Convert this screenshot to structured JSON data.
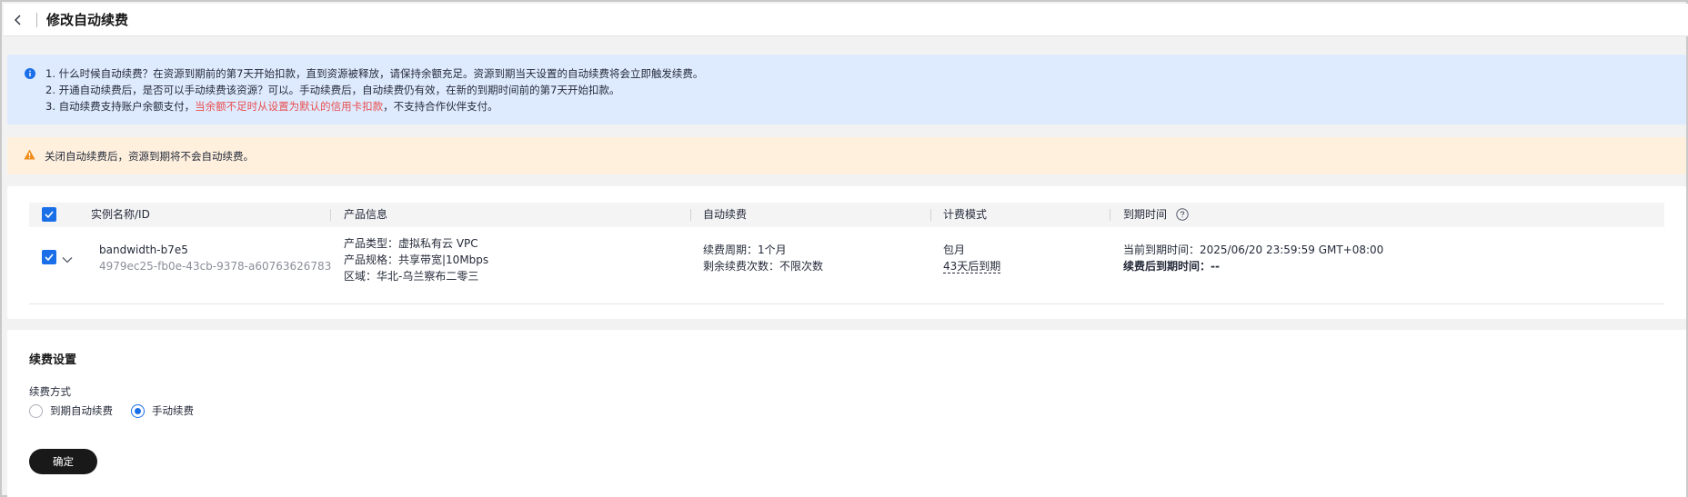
{
  "header": {
    "title": "修改自动续费"
  },
  "info_alert": {
    "lines": [
      "1. 什么时候自动续费？在资源到期前的第7天开始扣款，直到资源被释放，请保持余额充足。资源到期当天设置的自动续费将会立即触发续费。",
      "2. 开通自动续费后，是否可以手动续费该资源？可以。手动续费后，自动续费仍有效，在新的到期时间前的第7天开始扣款。"
    ],
    "line3_prefix": "3. 自动续费支持账户余额支付，",
    "line3_highlight": "当余额不足时从设置为默认的信用卡扣款",
    "line3_suffix": "，不支持合作伙伴支付。"
  },
  "warning_alert": {
    "text": "关闭自动续费后，资源到期将不会自动续费。"
  },
  "table": {
    "columns": {
      "instance": "实例名称/ID",
      "product": "产品信息",
      "auto_renew": "自动续费",
      "billing": "计费模式",
      "expiry": "到期时间"
    },
    "row": {
      "name": "bandwidth-b7e5",
      "id": "4979ec25-fb0e-43cb-9378-a60763626783",
      "product_type": "产品类型：虚拟私有云 VPC",
      "product_spec": "产品规格：共享带宽|10Mbps",
      "region": "区域：华北-乌兰察布二零三",
      "renew_period": "续费周期：1个月",
      "renew_remaining": "剩余续费次数：不限次数",
      "billing_mode": "包月",
      "billing_expire": "43天后到期",
      "current_expiry": "当前到期时间：2025/06/20 23:59:59 GMT+08:00",
      "after_renew_label": "续费后到期时间：",
      "after_renew_value": "--"
    }
  },
  "settings": {
    "title": "续费设置",
    "method_label": "续费方式",
    "options": [
      "到期自动续费",
      "手动续费"
    ],
    "selected": "手动续费",
    "confirm_label": "确定"
  },
  "colors": {
    "accent": "#1a6fe8",
    "info_bg": "#deebff",
    "warn_bg": "#fff0de",
    "warn_icon": "#f08c1a",
    "highlight_red": "#e84e4e",
    "button_bg": "#191919"
  },
  "icons": {
    "back": "chevron-left-icon",
    "info": "info-circle-icon",
    "warning": "warning-triangle-icon",
    "help": "question-circle-icon",
    "expand": "chevron-down-icon",
    "check": "checkmark-icon"
  }
}
